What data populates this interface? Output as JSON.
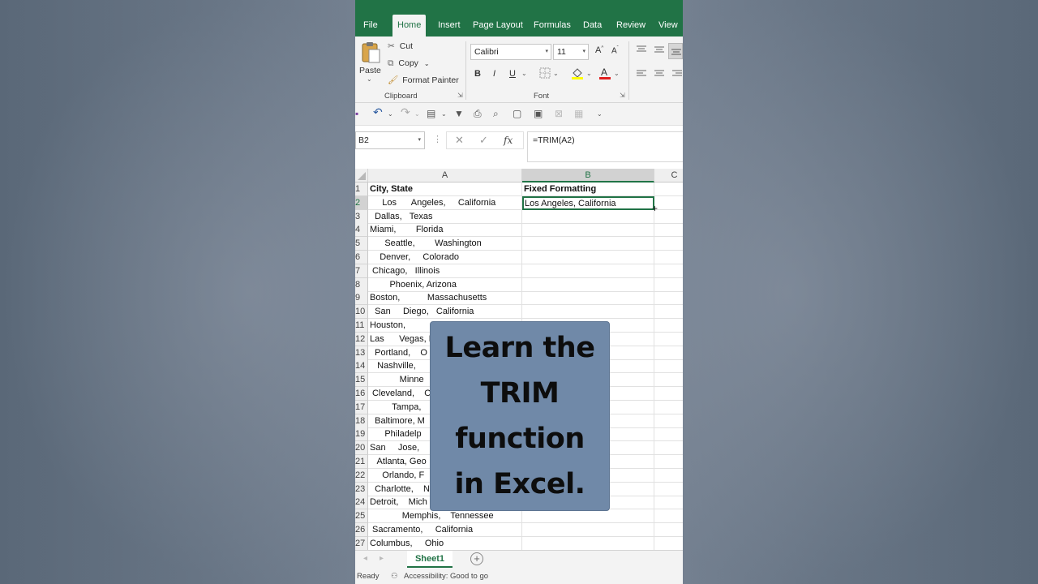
{
  "ribbon_tabs": [
    "File",
    "Home",
    "Insert",
    "Page Layout",
    "Formulas",
    "Data",
    "Review",
    "View"
  ],
  "clipboard": {
    "paste": "Paste",
    "cut": "Cut",
    "copy": "Copy",
    "format_painter": "Format Painter",
    "label": "Clipboard"
  },
  "font": {
    "name": "Calibri",
    "size": "11",
    "label": "Font",
    "bold": "B",
    "italic": "I",
    "underline": "U"
  },
  "formula_bar": {
    "name_box": "B2",
    "fx": "fx",
    "formula": "=TRIM(A2)"
  },
  "columns": [
    "A",
    "B",
    "C"
  ],
  "rows": [
    {
      "n": "1",
      "a": "City, State",
      "b": "Fixed Formatting"
    },
    {
      "n": "2",
      "a": "     Los      Angeles,     California",
      "b": "Los Angeles, California"
    },
    {
      "n": "3",
      "a": "  Dallas,   Texas",
      "b": ""
    },
    {
      "n": "4",
      "a": "Miami,        Florida",
      "b": ""
    },
    {
      "n": "5",
      "a": "      Seattle,        Washington",
      "b": ""
    },
    {
      "n": "6",
      "a": "    Denver,     Colorado",
      "b": ""
    },
    {
      "n": "7",
      "a": " Chicago,   Illinois",
      "b": ""
    },
    {
      "n": "8",
      "a": "        Phoenix, Arizona",
      "b": ""
    },
    {
      "n": "9",
      "a": "Boston,           Massachusetts",
      "b": ""
    },
    {
      "n": "10",
      "a": "  San     Diego,   California",
      "b": ""
    },
    {
      "n": "11",
      "a": "Houston,",
      "b": ""
    },
    {
      "n": "12",
      "a": "Las      Vegas, N",
      "b": ""
    },
    {
      "n": "13",
      "a": "  Portland,    O",
      "b": ""
    },
    {
      "n": "14",
      "a": "   Nashville,",
      "b": ""
    },
    {
      "n": "15",
      "a": "            Minne",
      "b": ""
    },
    {
      "n": "16",
      "a": " Cleveland,    O",
      "b": ""
    },
    {
      "n": "17",
      "a": "         Tampa,",
      "b": ""
    },
    {
      "n": "18",
      "a": "  Baltimore, M",
      "b": ""
    },
    {
      "n": "19",
      "a": "      Philadelp",
      "b": ""
    },
    {
      "n": "20",
      "a": "San     Jose,",
      "b": ""
    },
    {
      "n": "21",
      "a": "   Atlanta, Geo",
      "b": ""
    },
    {
      "n": "22",
      "a": "     Orlando, F",
      "b": ""
    },
    {
      "n": "23",
      "a": "  Charlotte,    N",
      "b": ""
    },
    {
      "n": "24",
      "a": "Detroit,    Mich",
      "b": ""
    },
    {
      "n": "25",
      "a": "             Memphis,    Tennessee",
      "b": ""
    },
    {
      "n": "26",
      "a": " Sacramento,     California",
      "b": ""
    },
    {
      "n": "27",
      "a": "Columbus,     Ohio",
      "b": ""
    }
  ],
  "sheet_tab": "Sheet1",
  "status": {
    "ready": "Ready",
    "accessibility": "Accessibility: Good to go"
  },
  "overlay": {
    "lines": [
      "Learn the",
      "TRIM",
      "function",
      "in Excel."
    ]
  },
  "colors": {
    "excel_green": "#217346",
    "overlay_bg": "#7089a8"
  }
}
